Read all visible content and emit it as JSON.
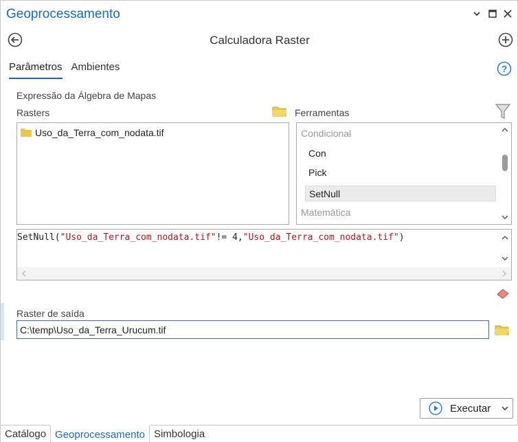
{
  "window": {
    "title": "Geoprocessamento",
    "controls": [
      "chevron-down-icon",
      "maximize-icon",
      "close-icon"
    ]
  },
  "header": {
    "tool_title": "Calculadora Raster",
    "back_icon": "back-arrow-icon",
    "add_icon": "add-circle-icon"
  },
  "tabs": [
    {
      "label": "Parâmetros",
      "active": true
    },
    {
      "label": "Ambientes",
      "active": false
    }
  ],
  "help_icon": "help-icon",
  "parameters": {
    "expression_label": "Expressão da Álgebra de Mapas",
    "rasters_label": "Rasters",
    "tools_label": "Ferramentas",
    "rasters": [
      "Uso_da_Terra_com_nodata.tif"
    ],
    "tool_groups": [
      {
        "name": "Condicional",
        "items": [
          "Con",
          "Pick",
          "SetNull"
        ]
      },
      {
        "name": "Matemática",
        "items": []
      }
    ],
    "selected_tool": "SetNull",
    "expression": {
      "func_open": "SetNull(",
      "arg1": "\"Uso_da_Terra_com_nodata.tif\"",
      "op": "!= 4,",
      "arg2": "\"Uso_da_Terra_com_nodata.tif\"",
      "func_close": ")"
    },
    "output_label": "Raster de saída",
    "output_value": "C:\\temp\\Uso_da_Terra_Urucum.tif"
  },
  "run_button": {
    "label": "Executar"
  },
  "bottom_tabs": [
    {
      "label": "Catálogo",
      "active": false
    },
    {
      "label": "Geoprocessamento",
      "active": true
    },
    {
      "label": "Simbologia",
      "active": false
    }
  ],
  "colors": {
    "accent": "#1a6bb5",
    "folder": "#e8c94a",
    "string": "#b5141f"
  }
}
